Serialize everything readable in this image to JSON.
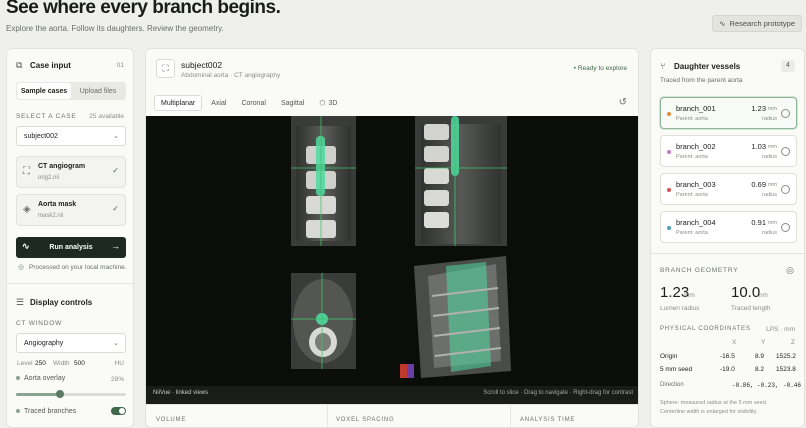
{
  "hero": {
    "title": "See where every branch begins.",
    "subtitle": "Explore the aorta. Follow its daughters. Review the geometry.",
    "research_label": "Research prototype"
  },
  "left": {
    "case_input_title": "Case input",
    "case_input_step": "01",
    "seg_sample": "Sample cases",
    "seg_upload": "Upload files",
    "select_case_label": "SELECT A CASE",
    "available": "25 available",
    "selected_case": "subject002",
    "files": [
      {
        "name": "CT angiogram",
        "file": "orig2.nii"
      },
      {
        "name": "Aorta mask",
        "file": "mask2.nii"
      }
    ],
    "run_label": "Run analysis",
    "local_note": "Processed on your local machine.",
    "display_title": "Display controls",
    "ct_window_label": "CT WINDOW",
    "window_preset": "Angiography",
    "level_label": "Level",
    "level_value": "250",
    "width_label": "Width",
    "width_value": "500",
    "hu_label": "HU",
    "overlay_label": "Aorta overlay",
    "overlay_value": "28%",
    "overlay_fraction": 0.4,
    "traced_label": "Traced branches",
    "traced_on": true
  },
  "center": {
    "subject": "subject002",
    "subtitle": "Abdominal aorta · CT angiography",
    "ready": "Ready to explore",
    "tabs": [
      "Multiplanar",
      "Axial",
      "Coronal",
      "Sagittal",
      "3D"
    ],
    "active_tab": "Multiplanar",
    "viewer_left": "NiiVue · linked views",
    "viewer_right": "Scroll to slice · Drag to navigate · Right-drag for contrast",
    "stats": [
      "VOLUME",
      "VOXEL SPACING",
      "ANALYSIS TIME"
    ]
  },
  "right": {
    "title": "Daughter vessels",
    "count": "4",
    "subtitle": "Traced from the parent aorta",
    "branches": [
      {
        "name": "branch_001",
        "parent": "Parent: aorta",
        "radius": "1.23",
        "unit": "mm",
        "label": "radius",
        "color": "#e28a3a"
      },
      {
        "name": "branch_002",
        "parent": "Parent: aorta",
        "radius": "1.03",
        "unit": "mm",
        "label": "radius",
        "color": "#c77ab8"
      },
      {
        "name": "branch_003",
        "parent": "Parent: aorta",
        "radius": "0.69",
        "unit": "mm",
        "label": "radius",
        "color": "#d9534f"
      },
      {
        "name": "branch_004",
        "parent": "Parent: aorta",
        "radius": "0.91",
        "unit": "mm",
        "label": "radius",
        "color": "#4aa3b8"
      }
    ],
    "geometry_label": "BRANCH GEOMETRY",
    "lumen_value": "1.23",
    "lumen_unit": "mm",
    "lumen_label": "Lumen radius",
    "traced_value": "10.0",
    "traced_unit": "mm",
    "traced_label": "Traced length",
    "coords_label": "PHYSICAL COORDINATES",
    "coords_unit": "LPS · mm",
    "axes": [
      "X",
      "Y",
      "Z"
    ],
    "origin_label": "Origin",
    "origin": [
      "-16.5",
      "8.9",
      "1525.2"
    ],
    "seed_label": "5 mm seed",
    "seed": [
      "-19.0",
      "8.2",
      "1523.8"
    ],
    "direction_label": "Direction",
    "direction": [
      "-0.86,",
      "-0.23,",
      "-0.46"
    ],
    "note1": "Sphere: measured radius at the 5 mm seed.",
    "note2": "Centerline width is enlarged for visibility."
  },
  "colors": {
    "accent": "#3f6a4a",
    "aorta_overlay": "#4fd9a0",
    "crosshair": "#3cc66a",
    "dark_button": "#1e2a21"
  }
}
